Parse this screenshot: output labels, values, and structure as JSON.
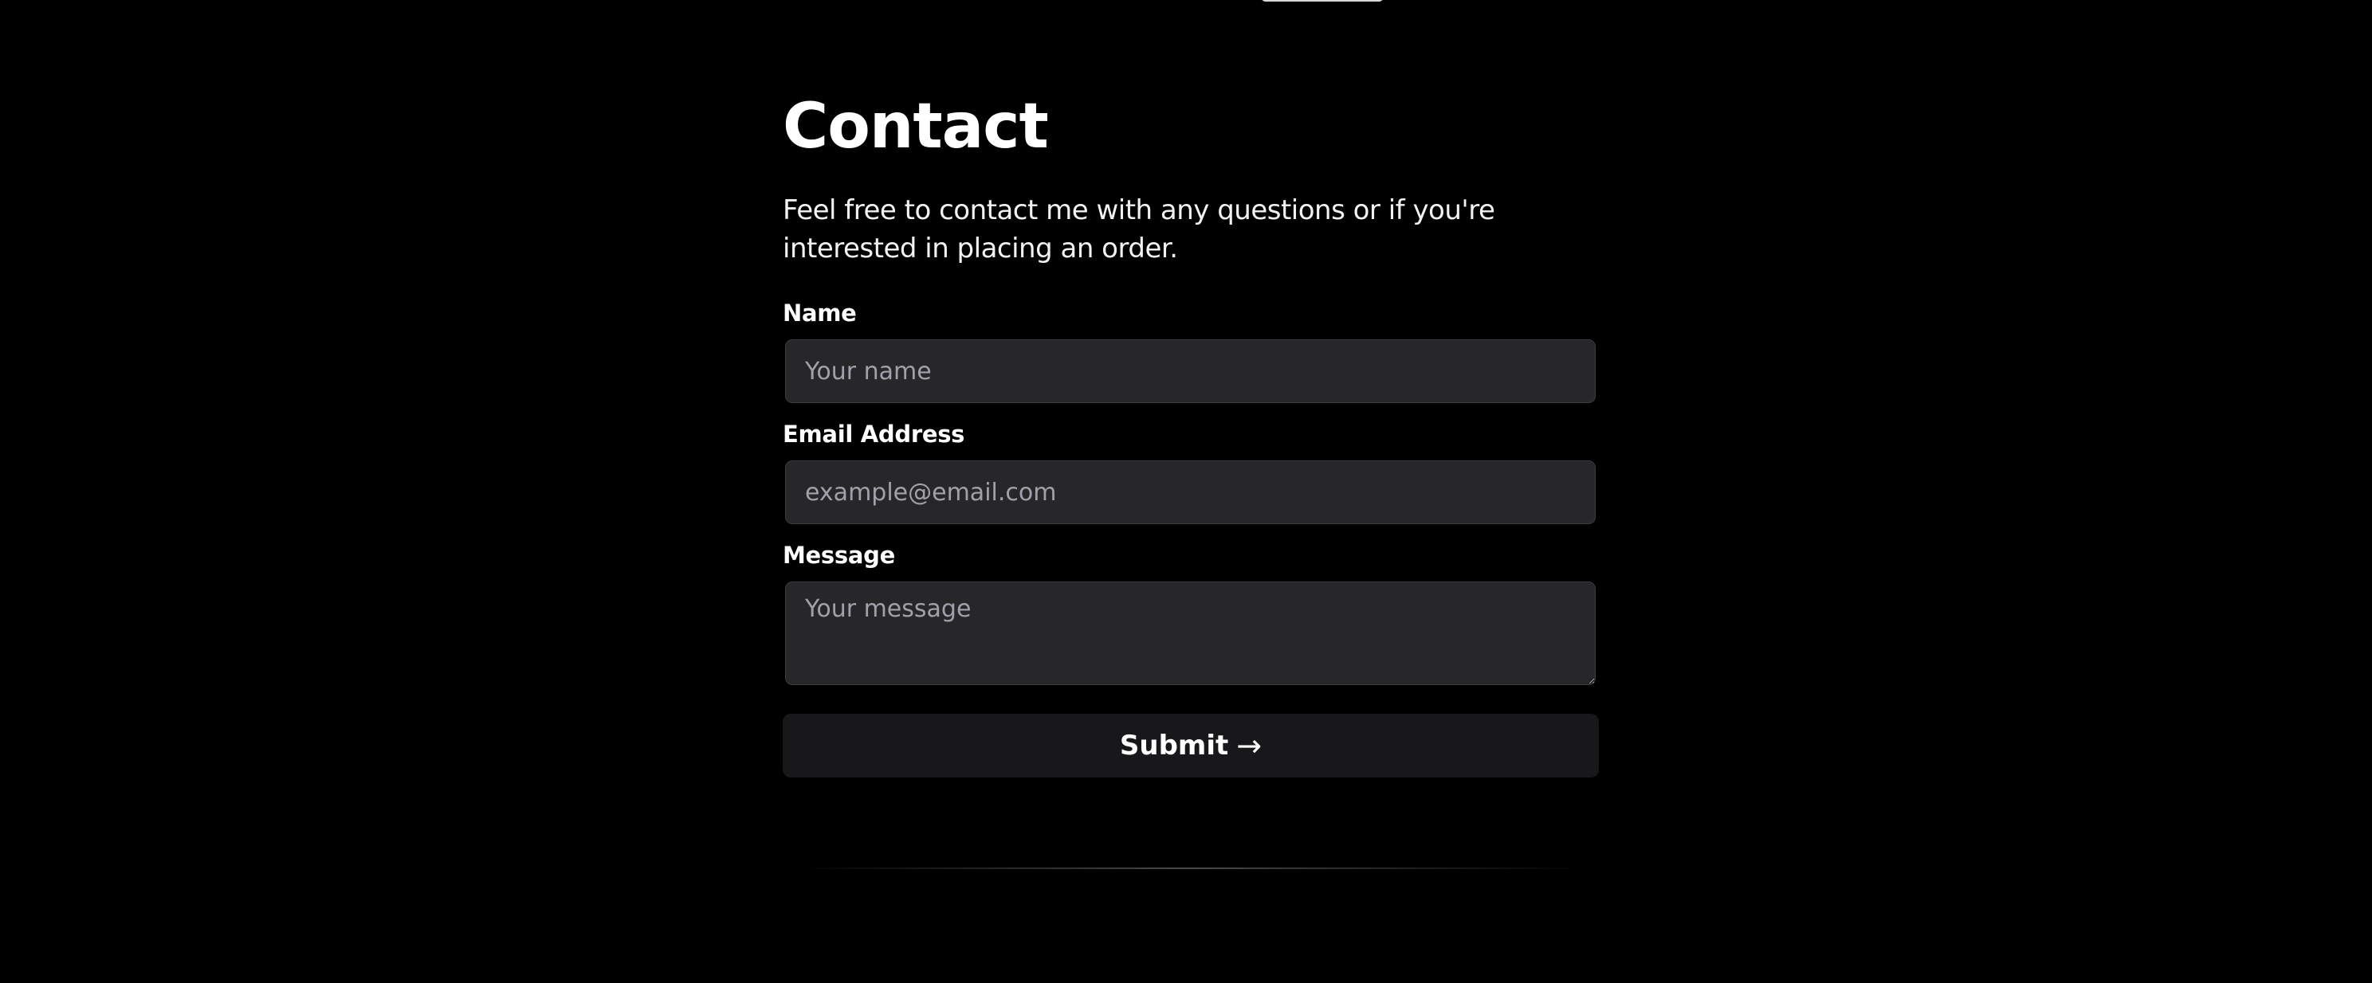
{
  "contact": {
    "title": "Contact",
    "intro": "Feel free to contact me with any questions or if you're interested in placing an order.",
    "fields": {
      "name": {
        "label": "Name",
        "placeholder": "Your name",
        "value": ""
      },
      "email": {
        "label": "Email Address",
        "placeholder": "example@email.com",
        "value": ""
      },
      "message": {
        "label": "Message",
        "placeholder": "Your message",
        "value": ""
      }
    },
    "submit_label": "Submit",
    "submit_icon": "→"
  },
  "icons": {
    "submit": "right-arrow-icon"
  },
  "colors": {
    "page_background": "#000000",
    "text": "#ffffff",
    "input_background": "#27272a",
    "input_border": "#3b3b40",
    "placeholder": "#a1a1aa",
    "button_background": "#18181b"
  }
}
